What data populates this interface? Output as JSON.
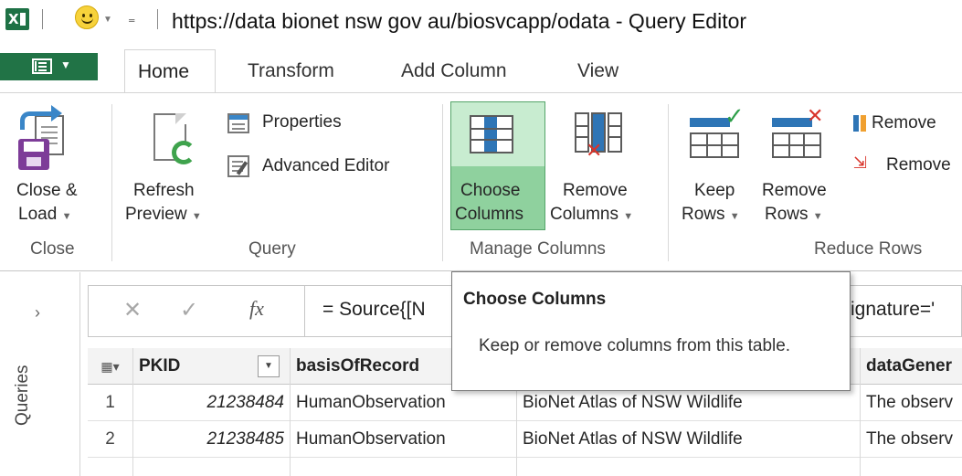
{
  "window": {
    "title": "https://data bionet nsw gov au/biosvcapp/odata - Query Editor",
    "app_icon": "excel-icon",
    "qat_icon": "smiley-icon"
  },
  "tabs": {
    "home": "Home",
    "transform": "Transform",
    "add_column": "Add Column",
    "view": "View"
  },
  "ribbon": {
    "close_group": {
      "label": "Close",
      "close_load_line1": "Close &",
      "close_load_line2": "Load"
    },
    "query_group": {
      "label": "Query",
      "refresh_line1": "Refresh",
      "refresh_line2": "Preview",
      "properties": "Properties",
      "advanced_editor": "Advanced Editor"
    },
    "manage_columns_group": {
      "label": "Manage Columns",
      "choose_line1": "Choose",
      "choose_line2": "Columns",
      "remove_line1": "Remove",
      "remove_line2": "Columns"
    },
    "reduce_rows_group": {
      "label": "Reduce Rows",
      "keep_line1": "Keep",
      "keep_line2": "Rows",
      "remove_line1": "Remove",
      "remove_line2": "Rows",
      "remove_small_1": "Remove",
      "remove_small_2": "Remove"
    }
  },
  "queries_pane": {
    "label": "Queries"
  },
  "formula_bar": {
    "fx": "fx",
    "formula_start": "= Source{[N",
    "formula_end": "ignature='"
  },
  "tooltip": {
    "title": "Choose Columns",
    "description": "Keep or remove columns from this table."
  },
  "grid": {
    "columns": [
      "PKID",
      "basisOfRecord",
      "",
      "dataGener"
    ],
    "rows": [
      {
        "index": "1",
        "pkid": "21238484",
        "basis": "HumanObservation",
        "source": "BioNet Atlas of NSW Wildlife",
        "gen": "The observ"
      },
      {
        "index": "2",
        "pkid": "21238485",
        "basis": "HumanObservation",
        "source": "BioNet Atlas of NSW Wildlife",
        "gen": "The observ"
      }
    ]
  },
  "colors": {
    "excel_green": "#217346",
    "highlight_green": "#8fd19e",
    "accent_blue": "#2e75b6"
  }
}
